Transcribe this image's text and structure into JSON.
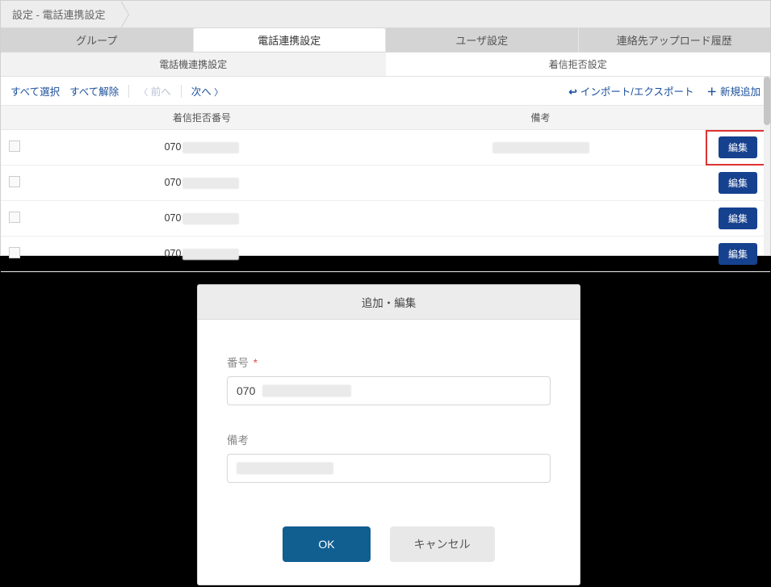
{
  "breadcrumb": {
    "label": "設定 - 電話連携設定"
  },
  "tabs_primary": [
    {
      "label": "グループ",
      "active": false
    },
    {
      "label": "電話連携設定",
      "active": true
    },
    {
      "label": "ユーザ設定",
      "active": false
    },
    {
      "label": "連絡先アップロード履歴",
      "active": false
    }
  ],
  "tabs_secondary": [
    {
      "label": "電話機連携設定",
      "active": false
    },
    {
      "label": "着信拒否設定",
      "active": true
    }
  ],
  "toolbar": {
    "select_all": "すべて選択",
    "deselect_all": "すべて解除",
    "prev": "前へ",
    "next": "次へ",
    "import_export": "インポート/エクスポート",
    "add_new": "新規追加"
  },
  "table": {
    "headers": {
      "number": "着信拒否番号",
      "note": "備考"
    },
    "rows": [
      {
        "prefix": "070",
        "note_present": true,
        "highlight": true
      },
      {
        "prefix": "070",
        "note_present": false,
        "highlight": false
      },
      {
        "prefix": "070",
        "note_present": false,
        "highlight": false
      },
      {
        "prefix": "070",
        "note_present": false,
        "highlight": false
      }
    ],
    "edit_label": "編集"
  },
  "modal": {
    "title": "追加・編集",
    "label_number": "番号",
    "required_mark": "*",
    "number_prefix": "070",
    "label_note": "備考",
    "ok": "OK",
    "cancel": "キャンセル"
  }
}
